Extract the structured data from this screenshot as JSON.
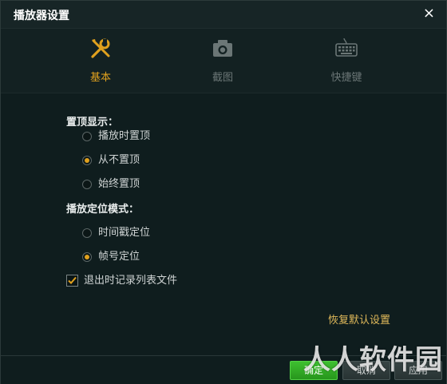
{
  "window": {
    "title": "播放器设置",
    "close_icon": "×"
  },
  "tabs": [
    {
      "label": "基本",
      "icon": "wrench-screwdriver-icon",
      "active": true
    },
    {
      "label": "截图",
      "icon": "camera-icon",
      "active": false
    },
    {
      "label": "快捷键",
      "icon": "keyboard-icon",
      "active": false
    }
  ],
  "topmost": {
    "title": "置顶显示：",
    "options": [
      {
        "label": "播放时置顶",
        "checked": false
      },
      {
        "label": "从不置顶",
        "checked": true
      },
      {
        "label": "始终置顶",
        "checked": false
      }
    ]
  },
  "seek_mode": {
    "title": "播放定位模式：",
    "options": [
      {
        "label": "时间戳定位",
        "checked": false
      },
      {
        "label": "帧号定位",
        "checked": true
      }
    ]
  },
  "record_on_exit": {
    "label": "退出时记录列表文件",
    "checked": true
  },
  "restore_defaults_label": "恢复默认设置",
  "footer": {
    "ok_label": "确定",
    "cancel_label": "取消",
    "apply_label": "应用"
  },
  "watermark": "人人软件园",
  "colors": {
    "accent": "#e0a11e",
    "background": "#0f1d1e",
    "primary_button": "#2fa823"
  }
}
